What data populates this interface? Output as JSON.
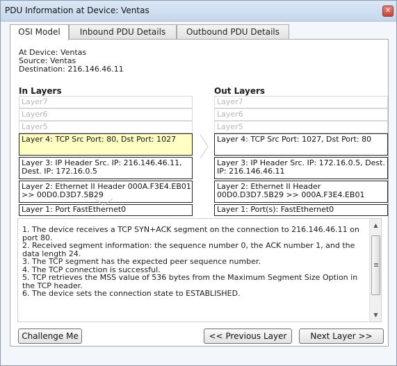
{
  "window": {
    "title": "PDU Information at Device: Ventas"
  },
  "tabs": [
    {
      "label": "OSI Model"
    },
    {
      "label": "Inbound PDU Details"
    },
    {
      "label": "Outbound PDU Details"
    }
  ],
  "info": {
    "device": "At Device: Ventas",
    "source": "Source: Ventas",
    "destination": "Destination: 216.146.46.11"
  },
  "in_layers": {
    "title": "In Layers",
    "items": [
      "Layer7",
      "Layer6",
      "Layer5",
      "Layer 4: TCP Src Port: 80, Dst Port: 1027",
      "Layer 3: IP Header Src. IP: 216.146.46.11, Dest. IP: 172.16.0.5",
      "Layer 2: Ethernet II Header 000A.F3E4.EB01 >> 00D0.D3D7.5B29",
      "Layer 1: Port FastEthernet0"
    ]
  },
  "out_layers": {
    "title": "Out Layers",
    "items": [
      "Layer7",
      "Layer6",
      "Layer5",
      "Layer 4: TCP Src Port: 1027, Dst Port: 80",
      "Layer 3: IP Header Src. IP: 172.16.0.5, Dest. IP: 216.146.46.11",
      "Layer 2: Ethernet II Header 00D0.D3D7.5B29 >> 000A.F3E4.EB01",
      "Layer 1: Port(s): FastEthernet0"
    ]
  },
  "description": [
    "1. The device receives a TCP SYN+ACK segment on the connection to 216.146.46.11 on port 80.",
    "2. Received segment information: the sequence number 0, the ACK number 1, and the data length 24.",
    "3. The TCP segment has the expected peer sequence number.",
    "4. The TCP connection is successful.",
    "5. TCP retrieves the MSS value of 536 bytes from the Maximum Segment Size Option in the TCP header.",
    "6. The device sets the connection state to ESTABLISHED."
  ],
  "buttons": {
    "challenge": "Challenge Me",
    "previous": "<< Previous Layer",
    "next": "Next Layer >>"
  },
  "icons": {
    "close": "close-icon",
    "scroll_up": "scroll-up-icon",
    "scroll_down": "scroll-down-icon"
  },
  "colors": {
    "selected_layer": "#ffffc4",
    "close_button": "#c7443a"
  }
}
